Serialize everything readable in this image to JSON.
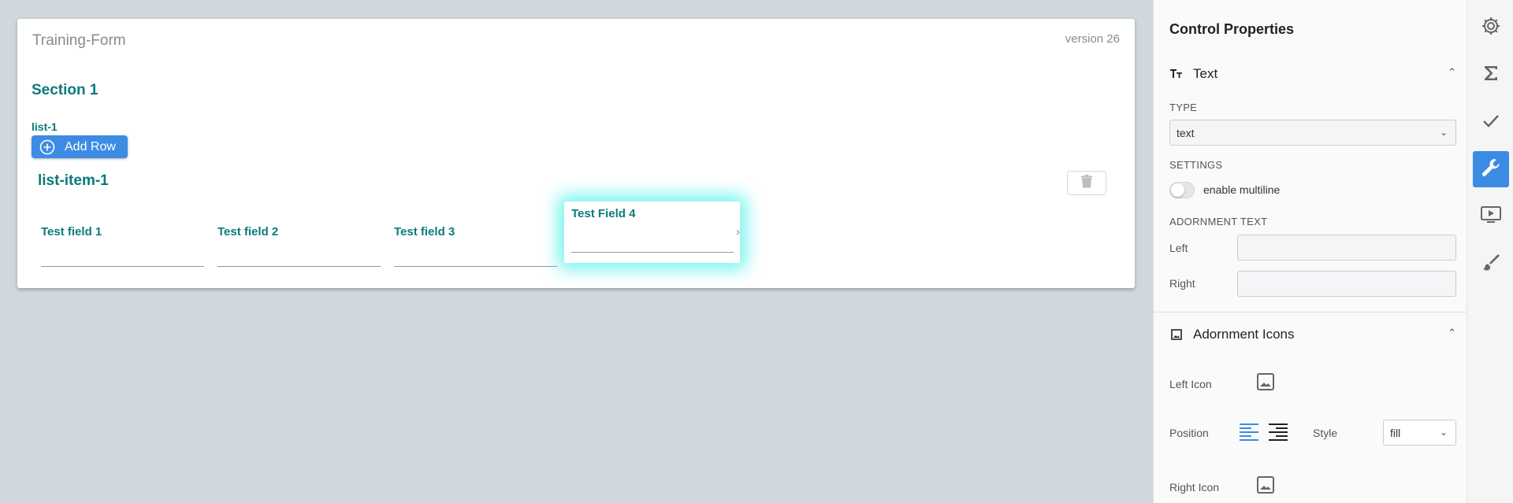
{
  "form": {
    "title": "Training-Form",
    "version": "version 26",
    "section_title": "Section 1",
    "list_label": "list-1",
    "add_row_label": "Add Row",
    "list_item_title": "list-item-1",
    "fields": [
      {
        "label": "Test field 1"
      },
      {
        "label": "Test field 2"
      },
      {
        "label": "Test field 3"
      },
      {
        "label": "Test Field 4",
        "selected": true
      }
    ]
  },
  "panel": {
    "title": "Control Properties",
    "text_section": {
      "title": "Text",
      "type_label": "TYPE",
      "type_value": "text",
      "settings_label": "SETTINGS",
      "multiline_label": "enable multiline",
      "multiline_enabled": false,
      "adornment_text_label": "ADORNMENT TEXT",
      "left_label": "Left",
      "right_label": "Right"
    },
    "icons_section": {
      "title": "Adornment Icons",
      "left_icon_label": "Left Icon",
      "position_label": "Position",
      "style_label": "Style",
      "style_value": "fill",
      "right_icon_label": "Right Icon"
    }
  },
  "rail": {
    "items": [
      {
        "icon": "gear-icon"
      },
      {
        "icon": "sigma-icon"
      },
      {
        "icon": "check-icon"
      },
      {
        "icon": "wrench-icon",
        "active": true
      },
      {
        "icon": "preview-icon"
      },
      {
        "icon": "brush-icon"
      }
    ]
  },
  "colors": {
    "accent": "#3c8ce4",
    "teal_text": "#0a7b7b",
    "selection_glow": "#00ebe1",
    "canvas_bg": "#cfd8dc"
  }
}
